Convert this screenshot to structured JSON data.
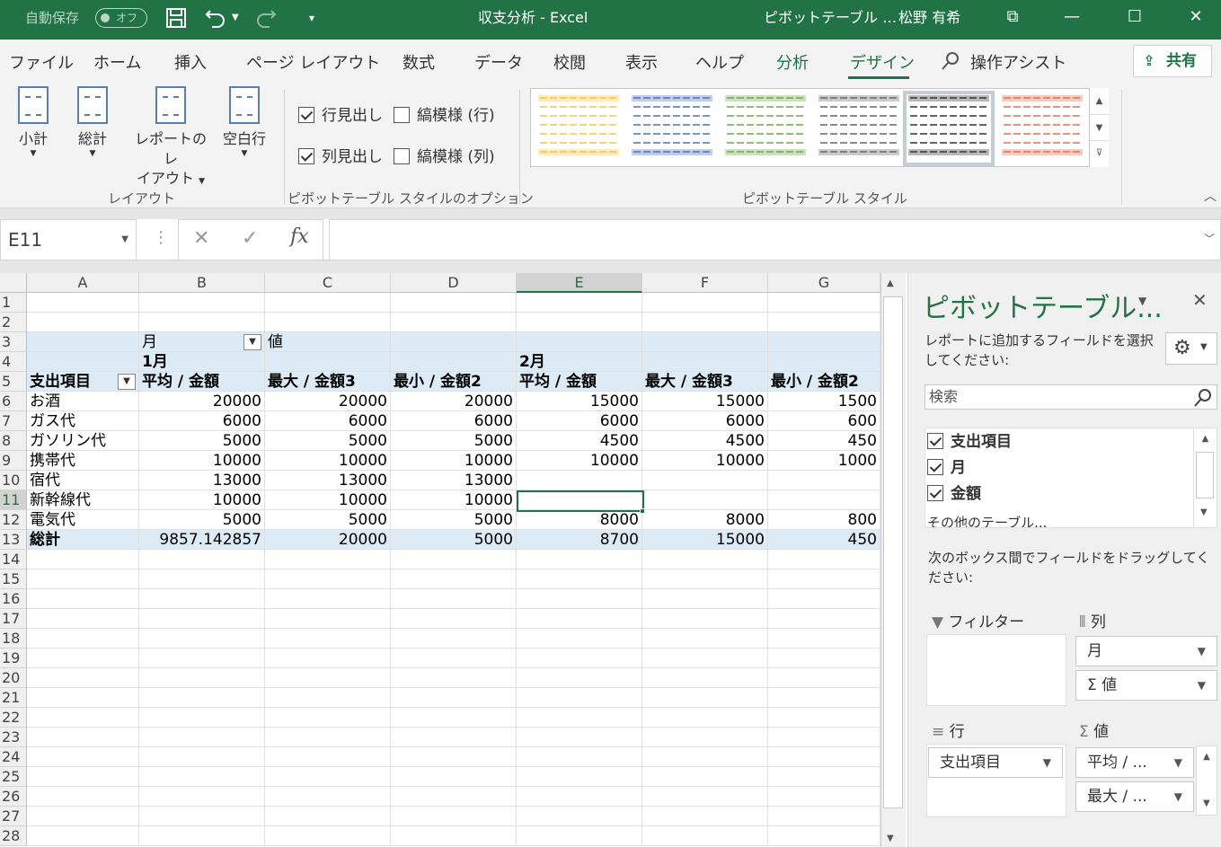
{
  "titlebar": {
    "autosave": "自動保存",
    "toggle": "オフ",
    "title": "収支分析 - Excel",
    "context": "ピボットテーブル …",
    "user": "松野 有希"
  },
  "menu": {
    "tabs": [
      "ファイル",
      "ホーム",
      "挿入",
      "ページ レイアウト",
      "数式",
      "データ",
      "校閲",
      "表示",
      "ヘルプ",
      "分析",
      "デザイン"
    ],
    "tell_me": "操作アシスト",
    "share": "共有"
  },
  "ribbon": {
    "subtotal": "小計",
    "grandtotal": "総計",
    "report_layout_1": "レポートのレ",
    "report_layout_2": "イアウト",
    "blank_rows": "空白行",
    "layout_group": "レイアウト",
    "row_headers": "行見出し",
    "col_headers": "列見出し",
    "banded_rows": "縞模様 (行)",
    "banded_cols": "縞模様 (列)",
    "options_group": "ピボットテーブル スタイルのオプション",
    "styles_group": "ピボットテーブル スタイル",
    "style_colors": [
      "#f4c542",
      "#4a74b4",
      "#6aa84f",
      "#666666",
      "#333333",
      "#e07050"
    ]
  },
  "formula": {
    "namebox": "E11",
    "fx": "fx"
  },
  "sheet": {
    "columns": [
      "A",
      "B",
      "C",
      "D",
      "E",
      "F",
      "G"
    ],
    "rows": [
      "1",
      "2",
      "3",
      "4",
      "5",
      "6",
      "7",
      "8",
      "9",
      "10",
      "11",
      "12",
      "13",
      "14",
      "15",
      "16",
      "17",
      "18",
      "19",
      "20",
      "21",
      "22",
      "23",
      "24",
      "25",
      "26",
      "27",
      "28"
    ],
    "r3": {
      "a": "",
      "b": "月",
      "c": "値"
    },
    "r4": {
      "b": "1月",
      "e": "2月"
    },
    "r5": [
      "支出項目",
      "平均 / 金額",
      "最大 / 金額3",
      "最小 / 金額2",
      "平均 / 金額",
      "最大 / 金額3",
      "最小 / 金額2"
    ],
    "data": [
      [
        "お酒",
        "20000",
        "20000",
        "20000",
        "15000",
        "15000",
        "1500"
      ],
      [
        "ガス代",
        "6000",
        "6000",
        "6000",
        "6000",
        "6000",
        "600"
      ],
      [
        "ガソリン代",
        "5000",
        "5000",
        "5000",
        "4500",
        "4500",
        "450"
      ],
      [
        "携帯代",
        "10000",
        "10000",
        "10000",
        "10000",
        "10000",
        "1000"
      ],
      [
        "宿代",
        "13000",
        "13000",
        "13000",
        "",
        "",
        ""
      ],
      [
        "新幹線代",
        "10000",
        "10000",
        "10000",
        "",
        "",
        ""
      ],
      [
        "電気代",
        "5000",
        "5000",
        "5000",
        "8000",
        "8000",
        "800"
      ],
      [
        "総計",
        "9857.142857",
        "20000",
        "5000",
        "8700",
        "15000",
        "450"
      ]
    ]
  },
  "pane": {
    "title": "ピボットテーブル...",
    "desc": "レポートに追加するフィールドを選択してください:",
    "search": "検索",
    "fields": [
      "支出項目",
      "月",
      "金額"
    ],
    "more_tables": "その他のテーブル...",
    "hint": "次のボックス間でフィールドをドラッグしてください:",
    "filters": "フィルター",
    "columns": "列",
    "rows": "行",
    "values": "値",
    "col_chips": [
      "月",
      "Σ 値"
    ],
    "row_chips": [
      "支出項目"
    ],
    "val_chips": [
      "平均 / ...",
      "最大 / ..."
    ]
  }
}
